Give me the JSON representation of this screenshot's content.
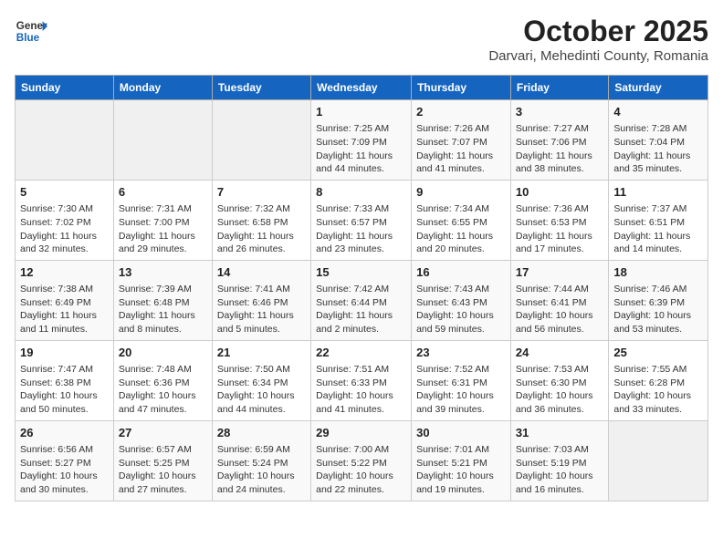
{
  "header": {
    "logo_general": "General",
    "logo_blue": "Blue",
    "month_title": "October 2025",
    "location": "Darvari, Mehedinti County, Romania"
  },
  "days_of_week": [
    "Sunday",
    "Monday",
    "Tuesday",
    "Wednesday",
    "Thursday",
    "Friday",
    "Saturday"
  ],
  "weeks": [
    [
      {
        "day": "",
        "info": ""
      },
      {
        "day": "",
        "info": ""
      },
      {
        "day": "",
        "info": ""
      },
      {
        "day": "1",
        "info": "Sunrise: 7:25 AM\nSunset: 7:09 PM\nDaylight: 11 hours and 44 minutes."
      },
      {
        "day": "2",
        "info": "Sunrise: 7:26 AM\nSunset: 7:07 PM\nDaylight: 11 hours and 41 minutes."
      },
      {
        "day": "3",
        "info": "Sunrise: 7:27 AM\nSunset: 7:06 PM\nDaylight: 11 hours and 38 minutes."
      },
      {
        "day": "4",
        "info": "Sunrise: 7:28 AM\nSunset: 7:04 PM\nDaylight: 11 hours and 35 minutes."
      }
    ],
    [
      {
        "day": "5",
        "info": "Sunrise: 7:30 AM\nSunset: 7:02 PM\nDaylight: 11 hours and 32 minutes."
      },
      {
        "day": "6",
        "info": "Sunrise: 7:31 AM\nSunset: 7:00 PM\nDaylight: 11 hours and 29 minutes."
      },
      {
        "day": "7",
        "info": "Sunrise: 7:32 AM\nSunset: 6:58 PM\nDaylight: 11 hours and 26 minutes."
      },
      {
        "day": "8",
        "info": "Sunrise: 7:33 AM\nSunset: 6:57 PM\nDaylight: 11 hours and 23 minutes."
      },
      {
        "day": "9",
        "info": "Sunrise: 7:34 AM\nSunset: 6:55 PM\nDaylight: 11 hours and 20 minutes."
      },
      {
        "day": "10",
        "info": "Sunrise: 7:36 AM\nSunset: 6:53 PM\nDaylight: 11 hours and 17 minutes."
      },
      {
        "day": "11",
        "info": "Sunrise: 7:37 AM\nSunset: 6:51 PM\nDaylight: 11 hours and 14 minutes."
      }
    ],
    [
      {
        "day": "12",
        "info": "Sunrise: 7:38 AM\nSunset: 6:49 PM\nDaylight: 11 hours and 11 minutes."
      },
      {
        "day": "13",
        "info": "Sunrise: 7:39 AM\nSunset: 6:48 PM\nDaylight: 11 hours and 8 minutes."
      },
      {
        "day": "14",
        "info": "Sunrise: 7:41 AM\nSunset: 6:46 PM\nDaylight: 11 hours and 5 minutes."
      },
      {
        "day": "15",
        "info": "Sunrise: 7:42 AM\nSunset: 6:44 PM\nDaylight: 11 hours and 2 minutes."
      },
      {
        "day": "16",
        "info": "Sunrise: 7:43 AM\nSunset: 6:43 PM\nDaylight: 10 hours and 59 minutes."
      },
      {
        "day": "17",
        "info": "Sunrise: 7:44 AM\nSunset: 6:41 PM\nDaylight: 10 hours and 56 minutes."
      },
      {
        "day": "18",
        "info": "Sunrise: 7:46 AM\nSunset: 6:39 PM\nDaylight: 10 hours and 53 minutes."
      }
    ],
    [
      {
        "day": "19",
        "info": "Sunrise: 7:47 AM\nSunset: 6:38 PM\nDaylight: 10 hours and 50 minutes."
      },
      {
        "day": "20",
        "info": "Sunrise: 7:48 AM\nSunset: 6:36 PM\nDaylight: 10 hours and 47 minutes."
      },
      {
        "day": "21",
        "info": "Sunrise: 7:50 AM\nSunset: 6:34 PM\nDaylight: 10 hours and 44 minutes."
      },
      {
        "day": "22",
        "info": "Sunrise: 7:51 AM\nSunset: 6:33 PM\nDaylight: 10 hours and 41 minutes."
      },
      {
        "day": "23",
        "info": "Sunrise: 7:52 AM\nSunset: 6:31 PM\nDaylight: 10 hours and 39 minutes."
      },
      {
        "day": "24",
        "info": "Sunrise: 7:53 AM\nSunset: 6:30 PM\nDaylight: 10 hours and 36 minutes."
      },
      {
        "day": "25",
        "info": "Sunrise: 7:55 AM\nSunset: 6:28 PM\nDaylight: 10 hours and 33 minutes."
      }
    ],
    [
      {
        "day": "26",
        "info": "Sunrise: 6:56 AM\nSunset: 5:27 PM\nDaylight: 10 hours and 30 minutes."
      },
      {
        "day": "27",
        "info": "Sunrise: 6:57 AM\nSunset: 5:25 PM\nDaylight: 10 hours and 27 minutes."
      },
      {
        "day": "28",
        "info": "Sunrise: 6:59 AM\nSunset: 5:24 PM\nDaylight: 10 hours and 24 minutes."
      },
      {
        "day": "29",
        "info": "Sunrise: 7:00 AM\nSunset: 5:22 PM\nDaylight: 10 hours and 22 minutes."
      },
      {
        "day": "30",
        "info": "Sunrise: 7:01 AM\nSunset: 5:21 PM\nDaylight: 10 hours and 19 minutes."
      },
      {
        "day": "31",
        "info": "Sunrise: 7:03 AM\nSunset: 5:19 PM\nDaylight: 10 hours and 16 minutes."
      },
      {
        "day": "",
        "info": ""
      }
    ]
  ]
}
